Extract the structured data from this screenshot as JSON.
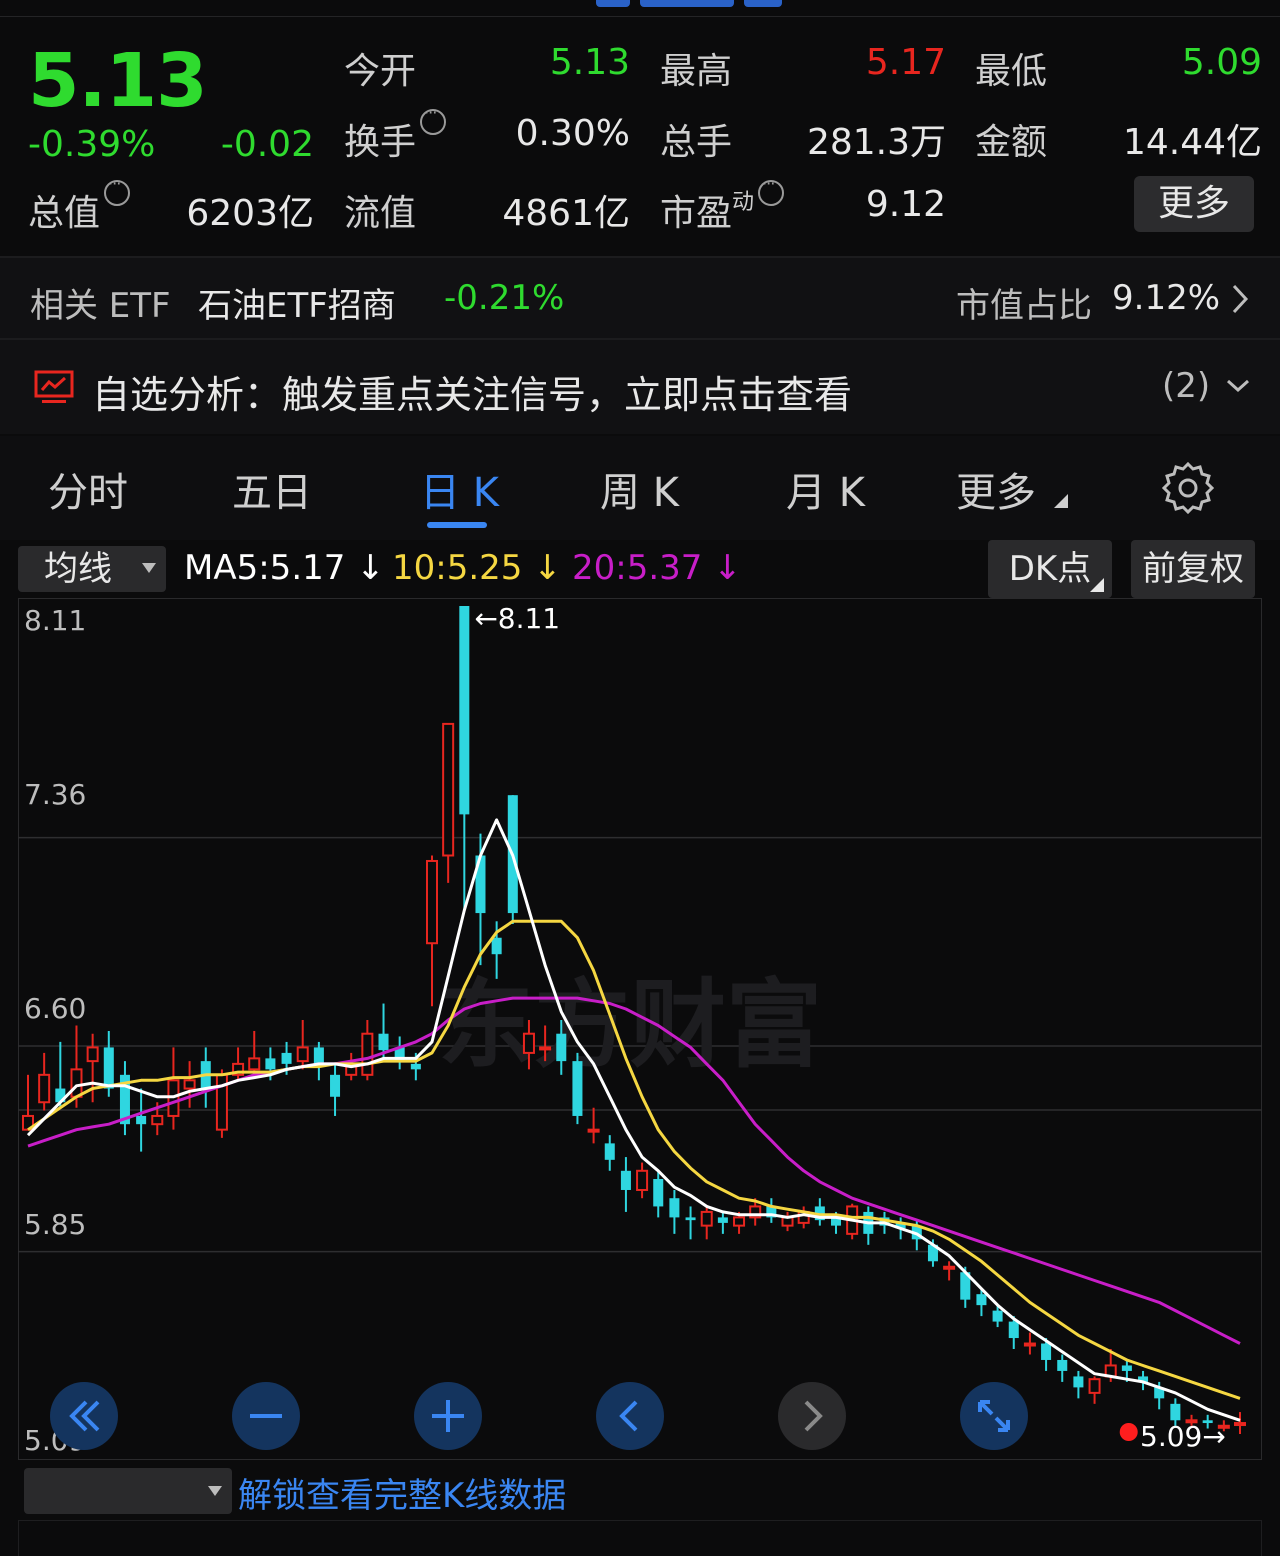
{
  "quote": {
    "price": "5.13",
    "change_pct": "-0.39%",
    "change_abs": "-0.02",
    "open_label": "今开",
    "open": "5.13",
    "high_label": "最高",
    "high": "5.17",
    "low_label": "最低",
    "low": "5.09",
    "turnover_label": "换手",
    "turnover": "0.30%",
    "volume_label": "总手",
    "volume": "281.3万",
    "amount_label": "金额",
    "amount": "14.44亿",
    "mktcap_label": "总值",
    "mktcap": "6203亿",
    "float_label": "流值",
    "float": "4861亿",
    "pe_label": "市盈",
    "pe_sup": "动",
    "pe": "9.12",
    "more_label": "更多"
  },
  "etf": {
    "label": "相关 ETF",
    "name": "石油ETF招商",
    "change": "-0.21%",
    "share_label": "市值占比",
    "share": "9.12%"
  },
  "analysis": {
    "text": "自选分析：触发重点关注信号，立即点击查看",
    "count": "(2)"
  },
  "tabs": [
    {
      "label": "分时"
    },
    {
      "label": "五日"
    },
    {
      "label": "日 K"
    },
    {
      "label": "周 K"
    },
    {
      "label": "月 K"
    },
    {
      "label": "更多"
    }
  ],
  "active_tab": "日 K",
  "ma_bar": {
    "selector": "均线",
    "ma5": "MA5:5.17",
    "ma10": "10:5.25",
    "ma20": "20:5.37",
    "dk_label": "DK点",
    "adjust_label": "前复权"
  },
  "colors": {
    "up": "#e8261f",
    "down": "#2fd6e0",
    "ma5": "#ffffff",
    "ma10": "#f5d742",
    "ma20": "#c81ec8",
    "accent": "#3a86f2",
    "green": "#2fdb2f"
  },
  "chart_data": {
    "type": "candlestick",
    "y_ticks": [
      "8.11",
      "7.36",
      "6.60",
      "5.85",
      "5.09"
    ],
    "ylim": [
      5.09,
      8.11
    ],
    "max_label": "8.11",
    "last_label": "5.09",
    "candles": [
      [
        6.2,
        6.25,
        6.4,
        6.2
      ],
      [
        6.3,
        6.4,
        6.48,
        6.27
      ],
      [
        6.35,
        6.3,
        6.52,
        6.28
      ],
      [
        6.32,
        6.42,
        6.58,
        6.28
      ],
      [
        6.45,
        6.5,
        6.55,
        6.3
      ],
      [
        6.5,
        6.35,
        6.56,
        6.32
      ],
      [
        6.4,
        6.22,
        6.45,
        6.18
      ],
      [
        6.25,
        6.22,
        6.35,
        6.12
      ],
      [
        6.22,
        6.25,
        6.3,
        6.18
      ],
      [
        6.25,
        6.38,
        6.5,
        6.2
      ],
      [
        6.35,
        6.38,
        6.45,
        6.28
      ],
      [
        6.45,
        6.35,
        6.5,
        6.28
      ],
      [
        6.2,
        6.4,
        6.42,
        6.17
      ],
      [
        6.4,
        6.44,
        6.5,
        6.38
      ],
      [
        6.42,
        6.46,
        6.56,
        6.4
      ],
      [
        6.46,
        6.42,
        6.5,
        6.38
      ],
      [
        6.48,
        6.44,
        6.52,
        6.4
      ],
      [
        6.45,
        6.5,
        6.6,
        6.42
      ],
      [
        6.5,
        6.43,
        6.52,
        6.38
      ],
      [
        6.4,
        6.32,
        6.44,
        6.25
      ],
      [
        6.4,
        6.44,
        6.48,
        6.38
      ],
      [
        6.4,
        6.55,
        6.6,
        6.38
      ],
      [
        6.55,
        6.49,
        6.66,
        6.45
      ],
      [
        6.5,
        6.45,
        6.54,
        6.42
      ],
      [
        6.44,
        6.42,
        6.48,
        6.38
      ],
      [
        6.88,
        7.18,
        7.2,
        6.65
      ],
      [
        7.2,
        7.68,
        7.68,
        7.1
      ],
      [
        8.11,
        7.35,
        8.11,
        7.0
      ],
      [
        7.2,
        6.99,
        7.28,
        6.8
      ],
      [
        6.9,
        6.84,
        6.96,
        6.75
      ],
      [
        7.42,
        6.99,
        7.42,
        6.95
      ],
      [
        6.48,
        6.55,
        6.6,
        6.42
      ],
      [
        6.5,
        6.5,
        6.58,
        6.45
      ],
      [
        6.55,
        6.45,
        6.6,
        6.4
      ],
      [
        6.45,
        6.25,
        6.48,
        6.22
      ],
      [
        6.2,
        6.2,
        6.28,
        6.15
      ],
      [
        6.15,
        6.09,
        6.18,
        6.05
      ],
      [
        6.05,
        5.98,
        6.1,
        5.9
      ],
      [
        5.98,
        6.05,
        6.08,
        5.95
      ],
      [
        6.02,
        5.92,
        6.05,
        5.88
      ],
      [
        5.95,
        5.88,
        5.98,
        5.82
      ],
      [
        5.88,
        5.87,
        5.92,
        5.8
      ],
      [
        5.85,
        5.9,
        5.92,
        5.8
      ],
      [
        5.88,
        5.86,
        5.9,
        5.82
      ],
      [
        5.85,
        5.88,
        5.9,
        5.82
      ],
      [
        5.88,
        5.92,
        5.95,
        5.85
      ],
      [
        5.92,
        5.88,
        5.95,
        5.86
      ],
      [
        5.85,
        5.88,
        5.9,
        5.83
      ],
      [
        5.86,
        5.9,
        5.92,
        5.84
      ],
      [
        5.92,
        5.87,
        5.95,
        5.85
      ],
      [
        5.88,
        5.85,
        5.9,
        5.82
      ],
      [
        5.82,
        5.92,
        5.93,
        5.8
      ],
      [
        5.9,
        5.82,
        5.92,
        5.78
      ],
      [
        5.88,
        5.85,
        5.9,
        5.82
      ],
      [
        5.86,
        5.84,
        5.88,
        5.8
      ],
      [
        5.85,
        5.8,
        5.87,
        5.76
      ],
      [
        5.78,
        5.72,
        5.8,
        5.7
      ],
      [
        5.7,
        5.7,
        5.72,
        5.65
      ],
      [
        5.68,
        5.58,
        5.7,
        5.55
      ],
      [
        5.6,
        5.56,
        5.62,
        5.52
      ],
      [
        5.54,
        5.5,
        5.56,
        5.48
      ],
      [
        5.5,
        5.44,
        5.52,
        5.4
      ],
      [
        5.42,
        5.42,
        5.46,
        5.38
      ],
      [
        5.42,
        5.36,
        5.44,
        5.32
      ],
      [
        5.36,
        5.32,
        5.38,
        5.28
      ],
      [
        5.3,
        5.26,
        5.32,
        5.22
      ],
      [
        5.24,
        5.29,
        5.3,
        5.2
      ],
      [
        5.3,
        5.34,
        5.4,
        5.28
      ],
      [
        5.34,
        5.32,
        5.36,
        5.28
      ],
      [
        5.3,
        5.28,
        5.32,
        5.25
      ],
      [
        5.26,
        5.22,
        5.28,
        5.18
      ],
      [
        5.2,
        5.14,
        5.22,
        5.12
      ],
      [
        5.14,
        5.14,
        5.16,
        5.12
      ],
      [
        5.14,
        5.13,
        5.16,
        5.11
      ],
      [
        5.12,
        5.12,
        5.14,
        5.1
      ],
      [
        5.13,
        5.13,
        5.17,
        5.09
      ]
    ],
    "ma5": [
      6.18,
      6.24,
      6.3,
      6.36,
      6.37,
      6.36,
      6.36,
      6.34,
      6.32,
      6.32,
      6.34,
      6.35,
      6.36,
      6.38,
      6.39,
      6.4,
      6.42,
      6.43,
      6.44,
      6.44,
      6.43,
      6.44,
      6.46,
      6.46,
      6.46,
      6.52,
      6.76,
      7.0,
      7.2,
      7.33,
      7.2,
      7.0,
      6.8,
      6.63,
      6.52,
      6.44,
      6.32,
      6.2,
      6.1,
      6.05,
      5.99,
      5.96,
      5.92,
      5.9,
      5.89,
      5.89,
      5.89,
      5.88,
      5.89,
      5.88,
      5.88,
      5.87,
      5.86,
      5.86,
      5.84,
      5.82,
      5.78,
      5.74,
      5.68,
      5.62,
      5.56,
      5.51,
      5.47,
      5.43,
      5.39,
      5.35,
      5.31,
      5.3,
      5.29,
      5.28,
      5.26,
      5.24,
      5.21,
      5.18,
      5.16,
      5.14
    ],
    "ma10": [
      6.2,
      6.24,
      6.28,
      6.32,
      6.35,
      6.36,
      6.37,
      6.38,
      6.38,
      6.39,
      6.39,
      6.4,
      6.4,
      6.41,
      6.41,
      6.41,
      6.42,
      6.43,
      6.43,
      6.44,
      6.44,
      6.44,
      6.45,
      6.45,
      6.45,
      6.48,
      6.58,
      6.72,
      6.84,
      6.92,
      6.96,
      6.96,
      6.96,
      6.96,
      6.9,
      6.78,
      6.62,
      6.46,
      6.32,
      6.2,
      6.12,
      6.06,
      6.01,
      5.98,
      5.95,
      5.94,
      5.92,
      5.91,
      5.9,
      5.89,
      5.89,
      5.88,
      5.88,
      5.87,
      5.86,
      5.85,
      5.83,
      5.8,
      5.76,
      5.72,
      5.67,
      5.62,
      5.57,
      5.53,
      5.49,
      5.45,
      5.42,
      5.39,
      5.36,
      5.34,
      5.32,
      5.3,
      5.28,
      5.26,
      5.24,
      5.22
    ],
    "ma20": [
      6.14,
      6.16,
      6.18,
      6.2,
      6.21,
      6.22,
      6.24,
      6.26,
      6.28,
      6.3,
      6.32,
      6.34,
      6.36,
      6.38,
      6.4,
      6.41,
      6.42,
      6.43,
      6.44,
      6.44,
      6.45,
      6.46,
      6.48,
      6.5,
      6.52,
      6.55,
      6.6,
      6.64,
      6.66,
      6.67,
      6.68,
      6.68,
      6.68,
      6.68,
      6.68,
      6.67,
      6.66,
      6.64,
      6.61,
      6.58,
      6.54,
      6.5,
      6.44,
      6.38,
      6.3,
      6.22,
      6.16,
      6.1,
      6.05,
      6.01,
      5.98,
      5.95,
      5.93,
      5.91,
      5.89,
      5.87,
      5.85,
      5.83,
      5.81,
      5.79,
      5.77,
      5.75,
      5.73,
      5.71,
      5.69,
      5.67,
      5.65,
      5.63,
      5.61,
      5.59,
      5.57,
      5.54,
      5.51,
      5.48,
      5.45,
      5.42
    ],
    "signal_dots": [
      {
        "index": 67,
        "price": 5.09
      }
    ]
  },
  "bottom": {
    "unlock_text": "解锁查看完整K线数据"
  }
}
